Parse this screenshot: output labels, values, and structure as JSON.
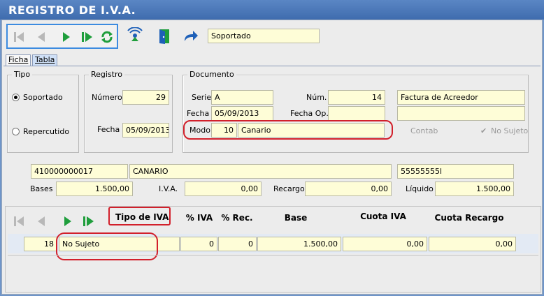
{
  "window": {
    "title": "REGISTRO DE I.V.A."
  },
  "toolbar": {
    "status_value": "Soportado"
  },
  "tabs": [
    {
      "label": "Ficha"
    },
    {
      "label": "Tabla"
    }
  ],
  "tipo": {
    "title": "Tipo",
    "options": [
      {
        "label": "Soportado",
        "selected": true
      },
      {
        "label": "Repercutido",
        "selected": false
      }
    ]
  },
  "registro": {
    "title": "Registro",
    "numero_label": "Número",
    "numero": "29",
    "fecha_label": "Fecha",
    "fecha": "05/09/2013"
  },
  "documento": {
    "title": "Documento",
    "serie_label": "Serie",
    "serie": "A",
    "num_label": "Núm.",
    "num": "14",
    "descripcion": "Factura de Acreedor",
    "fecha_label": "Fecha",
    "fecha": "05/09/2013",
    "fecha_op_label": "Fecha Op.",
    "fecha_op": "",
    "extra": "",
    "modo_label": "Modo",
    "modo_code": "10",
    "modo_name": "Canario",
    "contab_label": "Contab.",
    "no_sujeto_label": "No Sujeto"
  },
  "account": {
    "code": "410000000017",
    "name": "CANARIO",
    "nif": "55555555l"
  },
  "totals": {
    "bases_label": "Bases",
    "bases": "1.500,00",
    "iva_label": "I.V.A.",
    "iva": "0,00",
    "recargo_label": "Recargo",
    "recargo": "0,00",
    "liquido_label": "Líquido",
    "liquido": "1.500,00"
  },
  "grid": {
    "headers": [
      "Tipo de IVA",
      "% IVA",
      "% Rec.",
      "Base",
      "Cuota IVA",
      "Cuota Recargo"
    ],
    "row": {
      "code": "18",
      "tipo": "No Sujeto",
      "pct_iva": "0",
      "pct_rec": "0",
      "base": "1.500,00",
      "cuota_iva": "0,00",
      "cuota_recargo": "0,00"
    }
  },
  "colors": {
    "field_bg": "#fefdd7",
    "highlight": "#d2202b",
    "nav_green": "#1f9e3c",
    "title_bar": "#4a78b8"
  }
}
